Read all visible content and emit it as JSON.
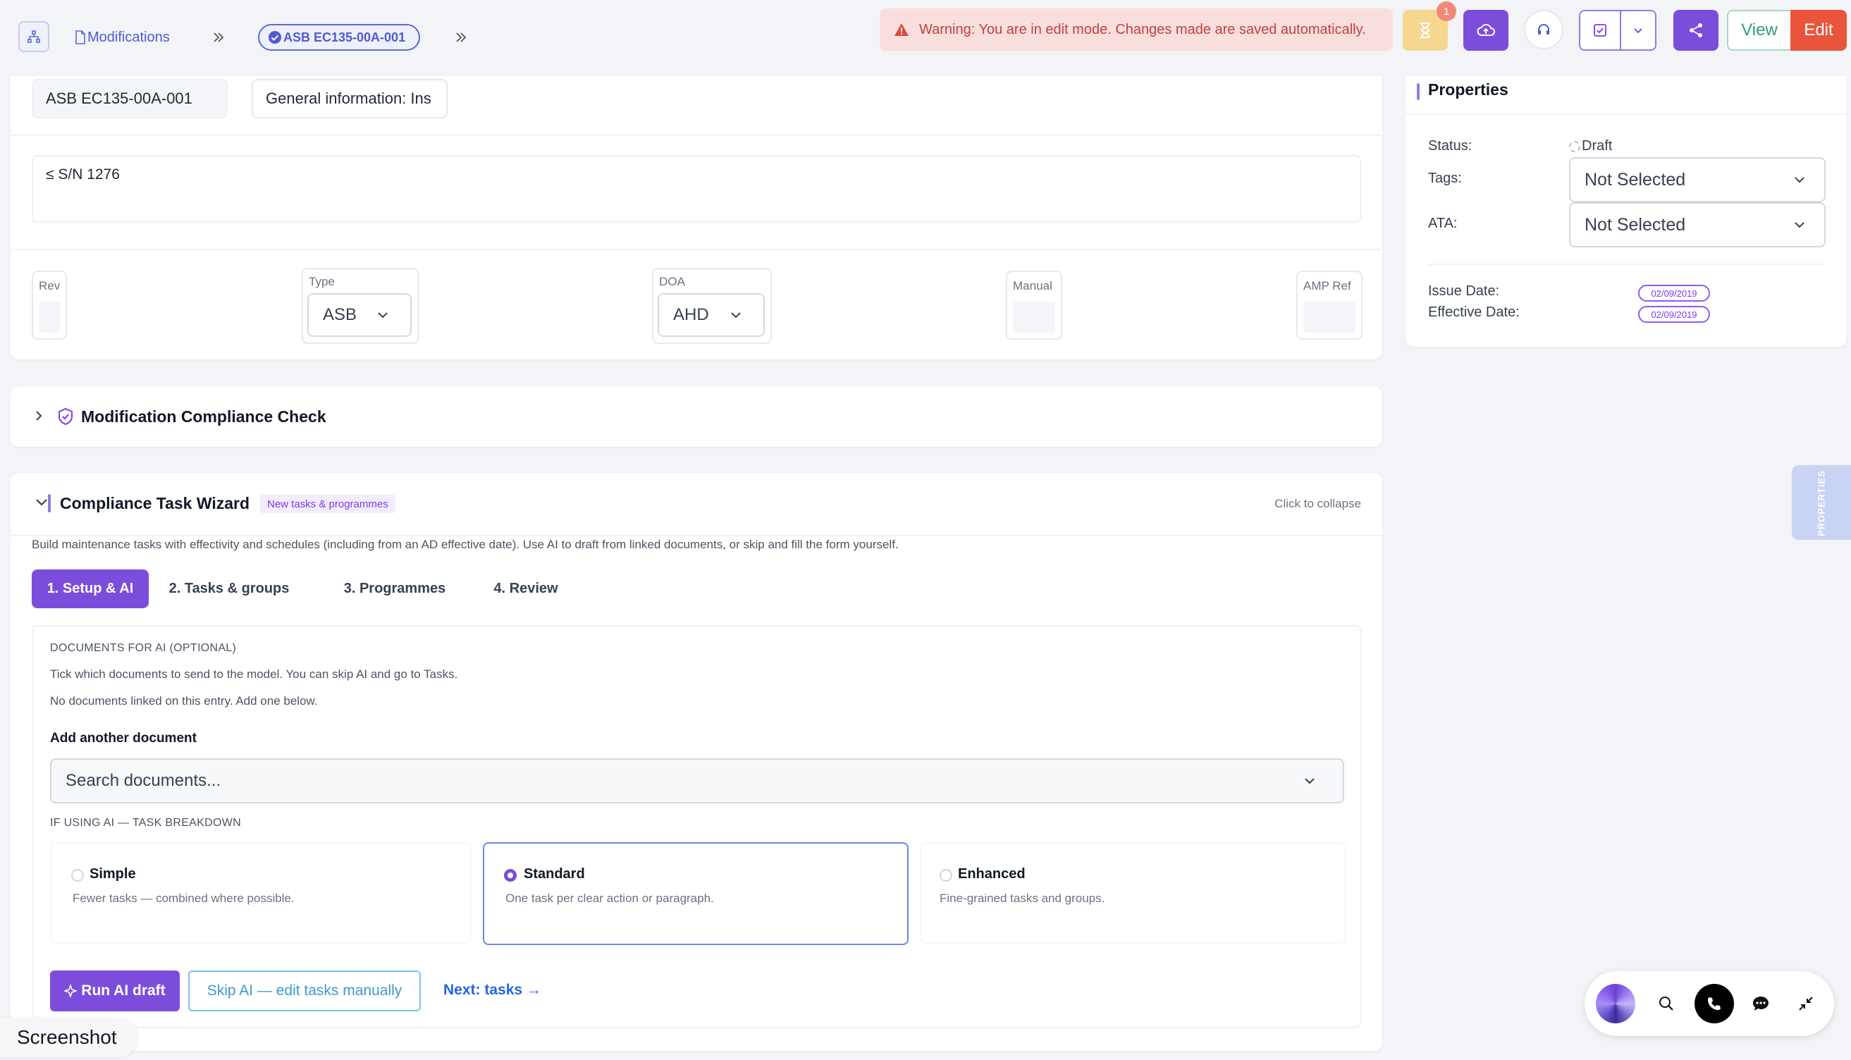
{
  "topbar": {
    "breadcrumb_modifications": "Modifications",
    "breadcrumb_record": "ASB EC135-00A-001",
    "warning_text": "Warning: You are in edit mode. Changes made are saved automatically.",
    "notification_count": "1",
    "view_label": "View",
    "edit_label": "Edit"
  },
  "header": {
    "doc_number": "ASB EC135-00A-001",
    "title": "General information: Ins",
    "applicability": "≤ S/N 1276"
  },
  "meta": {
    "rev_label": "Rev",
    "type_label": "Type",
    "type_value": "ASB",
    "doa_label": "DOA",
    "doa_value": "AHD",
    "manual_label": "Manual",
    "amp_ref_label": "AMP Ref"
  },
  "compliance_check": {
    "title": "Modification Compliance Check"
  },
  "wizard": {
    "title": "Compliance Task Wizard",
    "badge": "New tasks & programmes",
    "collapse_hint": "Click to collapse",
    "description": "Build maintenance tasks with effectivity and schedules (including from an AD effective date). Use AI to draft from linked documents, or skip and fill the form yourself.",
    "tabs": [
      {
        "label": "1. Setup & AI",
        "active": true
      },
      {
        "label": "2. Tasks & groups",
        "active": false
      },
      {
        "label": "3. Programmes",
        "active": false
      },
      {
        "label": "4. Review",
        "active": false
      }
    ],
    "docs_heading": "DOCUMENTS FOR AI (OPTIONAL)",
    "docs_hint": "Tick which documents to send to the model. You can skip AI and go to Tasks.",
    "docs_empty": "No documents linked on this entry. Add one below.",
    "add_doc_label": "Add another document",
    "search_placeholder": "Search documents...",
    "breakdown_heading": "IF USING AI — TASK BREAKDOWN",
    "options": [
      {
        "title": "Simple",
        "desc": "Fewer tasks — combined where possible.",
        "selected": false
      },
      {
        "title": "Standard",
        "desc": "One task per clear action or paragraph.",
        "selected": true
      },
      {
        "title": "Enhanced",
        "desc": "Fine-grained tasks and groups.",
        "selected": false
      }
    ],
    "run_ai_label": "Run AI draft",
    "skip_ai_label": "Skip AI — edit tasks manually",
    "next_label": "Next: tasks →"
  },
  "properties": {
    "title": "Properties",
    "status_label": "Status:",
    "status_value": "Draft",
    "tags_label": "Tags:",
    "tags_value": "Not Selected",
    "ata_label": "ATA:",
    "ata_value": "Not Selected",
    "issue_date_label": "Issue Date:",
    "issue_date_value": "02/09/2019",
    "effective_date_label": "Effective Date:",
    "effective_date_value": "02/09/2019",
    "side_tab": "PROPERTIES"
  },
  "screenshot_label": "Screenshot",
  "colors": {
    "accent": "#7c3aed",
    "warning_bg": "#f9dede",
    "warning_text": "#c2413b",
    "edit_bg": "#e8553b",
    "view_text": "#2f9e6e"
  }
}
